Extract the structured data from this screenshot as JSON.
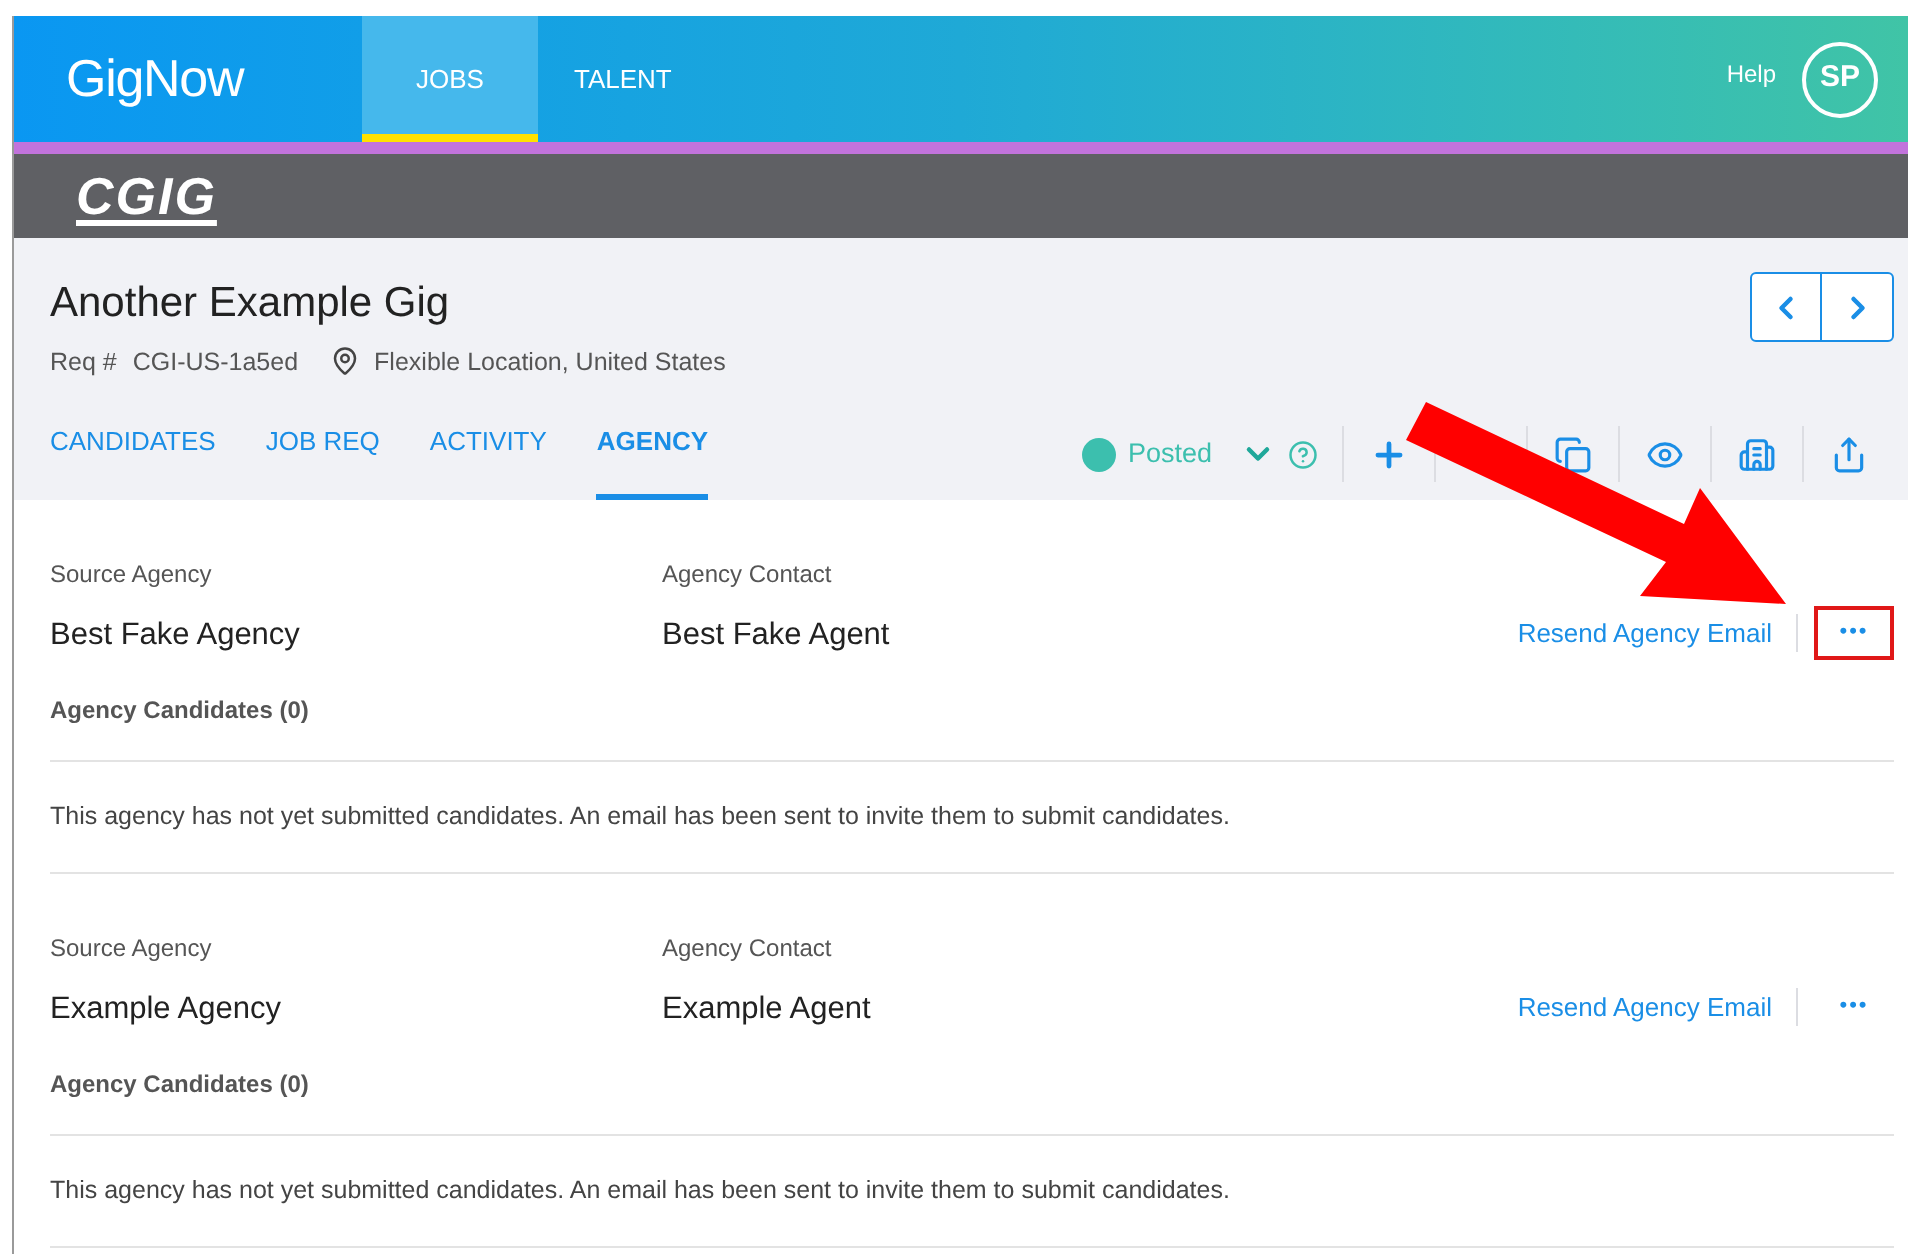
{
  "header": {
    "logo": "GigNow",
    "nav": [
      {
        "label": "JOBS",
        "selected": true
      },
      {
        "label": "TALENT",
        "selected": false
      }
    ],
    "help": "Help",
    "avatar": "SP"
  },
  "brand_bar": {
    "logo": "CGIG"
  },
  "job": {
    "title": "Another Example Gig",
    "req_label": "Req #",
    "req_id": "CGI-US-1a5ed",
    "location": "Flexible Location, United States"
  },
  "tabs": [
    {
      "label": "CANDIDATES",
      "selected": false
    },
    {
      "label": "JOB REQ",
      "selected": false
    },
    {
      "label": "ACTIVITY",
      "selected": false
    },
    {
      "label": "AGENCY",
      "selected": true
    }
  ],
  "status": {
    "label": "Posted",
    "color": "#3cbfae"
  },
  "agencies": [
    {
      "source_label": "Source Agency",
      "source": "Best Fake Agency",
      "contact_label": "Agency Contact",
      "contact": "Best Fake Agent",
      "resend": "Resend Agency Email",
      "more": "•••",
      "highlighted": true,
      "candidates_heading": "Agency Candidates (0)",
      "message": "This agency has not yet submitted candidates. An email has been sent to invite them to submit candidates."
    },
    {
      "source_label": "Source Agency",
      "source": "Example Agency",
      "contact_label": "Agency Contact",
      "contact": "Example Agent",
      "resend": "Resend Agency Email",
      "more": "•••",
      "highlighted": false,
      "candidates_heading": "Agency Candidates (0)",
      "message": "This agency has not yet submitted candidates. An email has been sent to invite them to submit candidates."
    }
  ]
}
